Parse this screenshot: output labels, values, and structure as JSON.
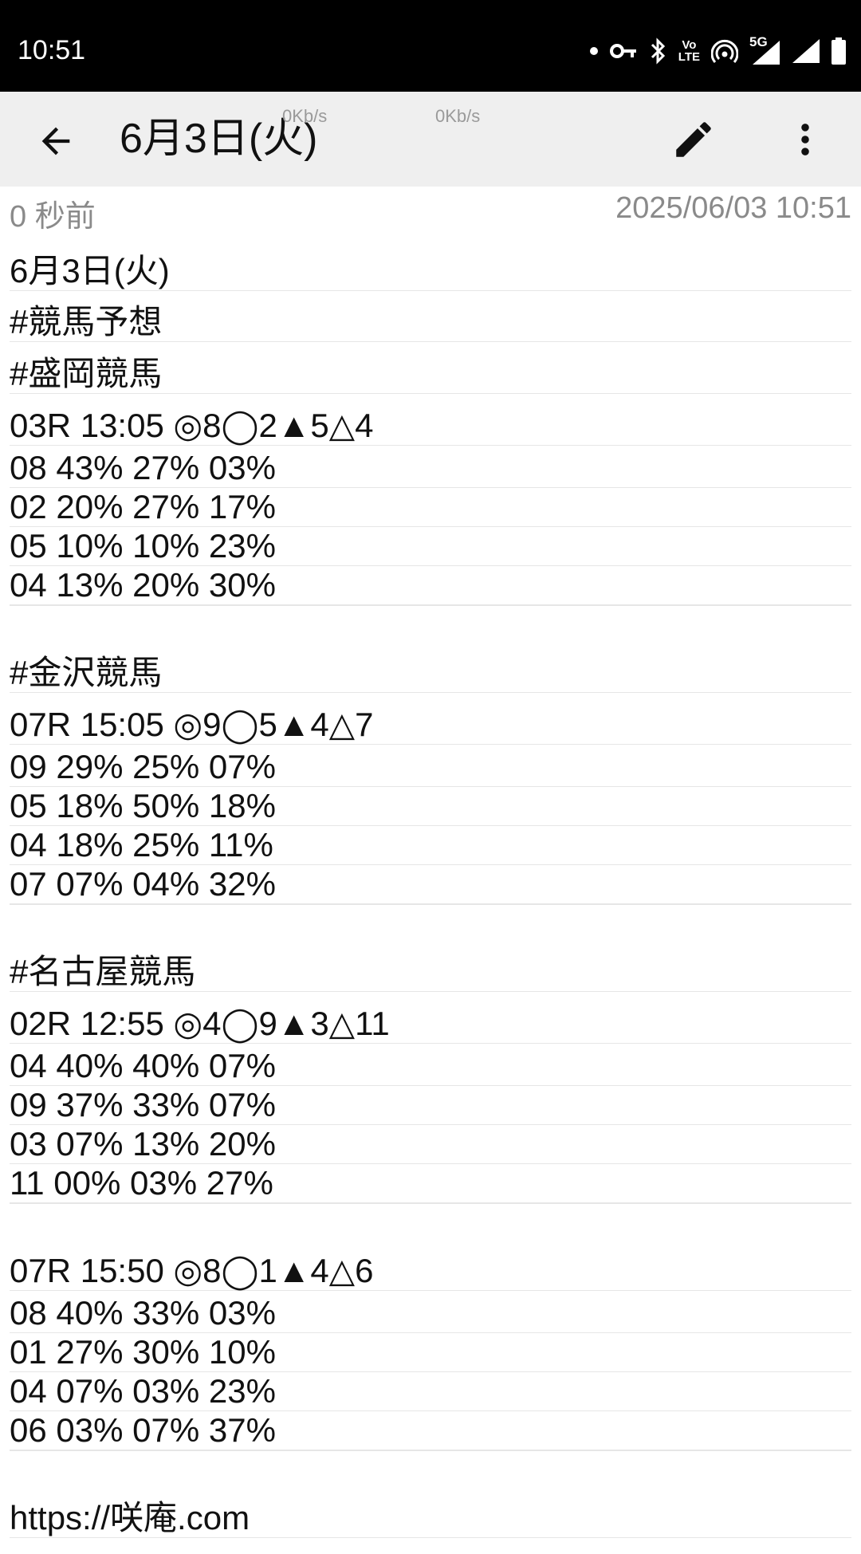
{
  "status_bar": {
    "time": "10:51",
    "icons": [
      "dot-icon",
      "vpn-key-icon",
      "bluetooth-icon",
      "volte-icon",
      "hotspot-icon",
      "5g-signal-icon",
      "signal-icon",
      "battery-icon"
    ],
    "volte_top": "Vo",
    "volte_bottom": "LTE",
    "network_type": "5G"
  },
  "app_bar": {
    "title": "6月3日(火)",
    "upload_speed": "0Kb/s",
    "download_speed": "0Kb/s"
  },
  "meta": {
    "relative_time": "0 秒前",
    "timestamp": "2025/06/03 10:51"
  },
  "note": {
    "lines": [
      "6月3日(火)",
      "#競馬予想",
      "#盛岡競馬",
      "03R 13:05 ◎8◯2▲5△4",
      "08 43% 27% 03%",
      "02 20% 27% 17%",
      "05 10% 10% 23%",
      "04 13% 20% 30%",
      "",
      "#金沢競馬",
      "07R 15:05 ◎9◯5▲4△7",
      "09 29% 25% 07%",
      "05 18% 50% 18%",
      "04 18% 25% 11%",
      "07 07% 04% 32%",
      "",
      "#名古屋競馬",
      "02R 12:55 ◎4◯9▲3△11",
      "04 40% 40% 07%",
      "09 37% 33% 07%",
      "03 07% 13% 20%",
      "11 00% 03% 27%",
      "",
      "07R 15:50 ◎8◯1▲4△6",
      "08 40% 33% 03%",
      "01 27% 30% 10%",
      "04 07% 03% 23%",
      "06 03% 07% 37%",
      "",
      "https://咲庵.com"
    ]
  }
}
